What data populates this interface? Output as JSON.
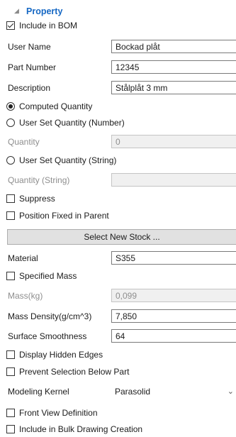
{
  "header": {
    "title": "Property",
    "collapse_glyph": "◢"
  },
  "include_in_bom": {
    "label": "Include in BOM",
    "checked": true
  },
  "user_name": {
    "label": "User Name",
    "value": "Bockad plåt"
  },
  "part_number": {
    "label": "Part Number",
    "value": "12345"
  },
  "description": {
    "label": "Description",
    "value": "Stålplåt 3 mm"
  },
  "computed_quantity": {
    "label": "Computed Quantity",
    "selected": true
  },
  "user_set_quantity_number": {
    "label": "User Set Quantity (Number)",
    "selected": false
  },
  "quantity": {
    "label": "Quantity",
    "value": "0"
  },
  "user_set_quantity_string": {
    "label": "User Set Quantity (String)",
    "selected": false
  },
  "quantity_string": {
    "label": "Quantity (String)",
    "value": ""
  },
  "suppress": {
    "label": "Suppress",
    "checked": false
  },
  "position_fixed": {
    "label": "Position Fixed in Parent",
    "checked": false
  },
  "select_new_stock": {
    "label": "Select New Stock ..."
  },
  "material": {
    "label": "Material",
    "value": "S355"
  },
  "specified_mass": {
    "label": "Specified Mass",
    "checked": false
  },
  "mass": {
    "label": "Mass(kg)",
    "value": "0,099"
  },
  "mass_density": {
    "label": "Mass Density(g/cm^3)",
    "value": "7,850"
  },
  "surface_smoothness": {
    "label": "Surface Smoothness",
    "value": "64"
  },
  "display_hidden_edges": {
    "label": "Display Hidden Edges",
    "checked": false
  },
  "prevent_selection": {
    "label": "Prevent Selection Below Part",
    "checked": false
  },
  "modeling_kernel": {
    "label": "Modeling Kernel",
    "value": "Parasolid",
    "arrow": "⌄"
  },
  "front_view_definition": {
    "label": "Front View Definition",
    "checked": false
  },
  "bulk_drawing": {
    "label": "Include in Bulk Drawing Creation",
    "checked": false
  }
}
